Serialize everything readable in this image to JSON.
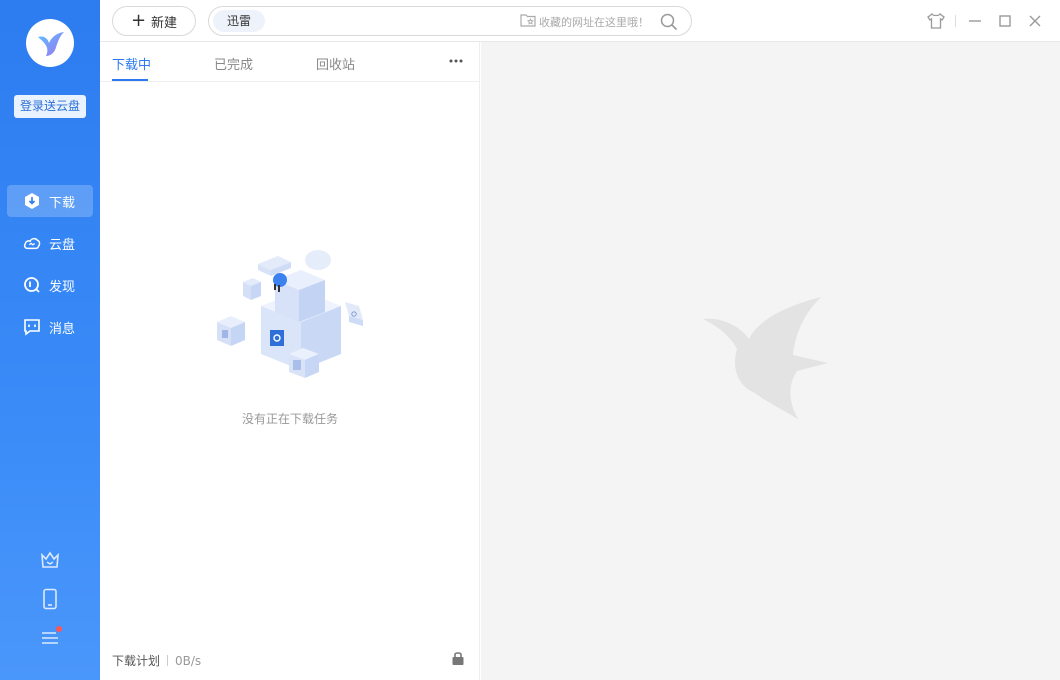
{
  "sidebar": {
    "login_label": "登录送云盘",
    "nav": [
      {
        "label": "下载",
        "icon": "download-hex-icon",
        "active": true
      },
      {
        "label": "云盘",
        "icon": "cloud-icon"
      },
      {
        "label": "发现",
        "icon": "discover-icon"
      },
      {
        "label": "消息",
        "icon": "message-icon"
      }
    ],
    "bottom_icons": [
      "crown-icon",
      "phone-icon",
      "menu-icon"
    ]
  },
  "topbar": {
    "new_label": "新建",
    "url_tag": "迅雷",
    "url_value": "",
    "favorites_hint": "收藏的网址在这里哦！"
  },
  "panel": {
    "tabs": [
      "下载中",
      "已完成",
      "回收站"
    ],
    "active_tab": "下载中",
    "empty_text": "没有正在下载任务",
    "footer_plan": "下载计划",
    "footer_speed": "0B/s"
  },
  "colors": {
    "accent": "#2b7af0",
    "sidebar_top": "#2d7cf0",
    "sidebar_bottom": "#4a97fb",
    "right_bg": "#f4f4f4"
  }
}
